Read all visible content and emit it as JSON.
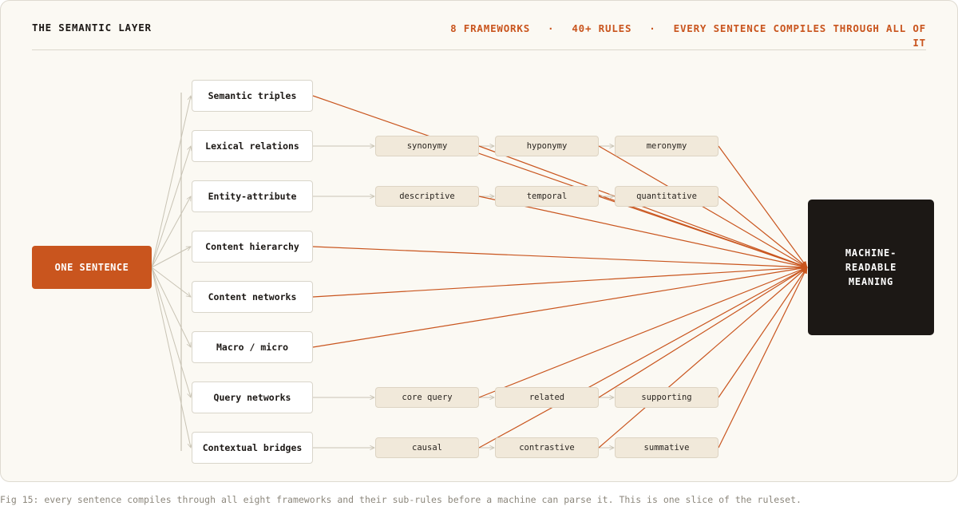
{
  "header": {
    "title": "THE SEMANTIC LAYER",
    "stats": [
      "8 FRAMEWORKS",
      "40+ RULES",
      "EVERY SENTENCE COMPILES THROUGH ALL OF IT"
    ],
    "separator": "·"
  },
  "source": {
    "label": "ONE SENTENCE"
  },
  "target": {
    "label": "MACHINE-READABLE MEANING"
  },
  "frameworks": [
    {
      "label": "Semantic triples",
      "subs": []
    },
    {
      "label": "Lexical relations",
      "subs": [
        "synonymy",
        "hyponymy",
        "meronymy"
      ]
    },
    {
      "label": "Entity-attribute",
      "subs": [
        "descriptive",
        "temporal",
        "quantitative"
      ]
    },
    {
      "label": "Content hierarchy",
      "subs": []
    },
    {
      "label": "Content networks",
      "subs": []
    },
    {
      "label": "Macro / micro",
      "subs": []
    },
    {
      "label": "Query networks",
      "subs": [
        "core query",
        "related",
        "supporting"
      ]
    },
    {
      "label": "Contextual bridges",
      "subs": [
        "causal",
        "contrastive",
        "summative"
      ]
    }
  ],
  "caption": "Fig 15: every sentence compiles through all eight frameworks and their sub-rules before a machine can parse it. This is one slice of the ruleset.",
  "colors": {
    "accent": "#c9551e",
    "dark": "#1c1815",
    "connector": "#c8c3b4",
    "sub_fill": "#f1e9da"
  }
}
